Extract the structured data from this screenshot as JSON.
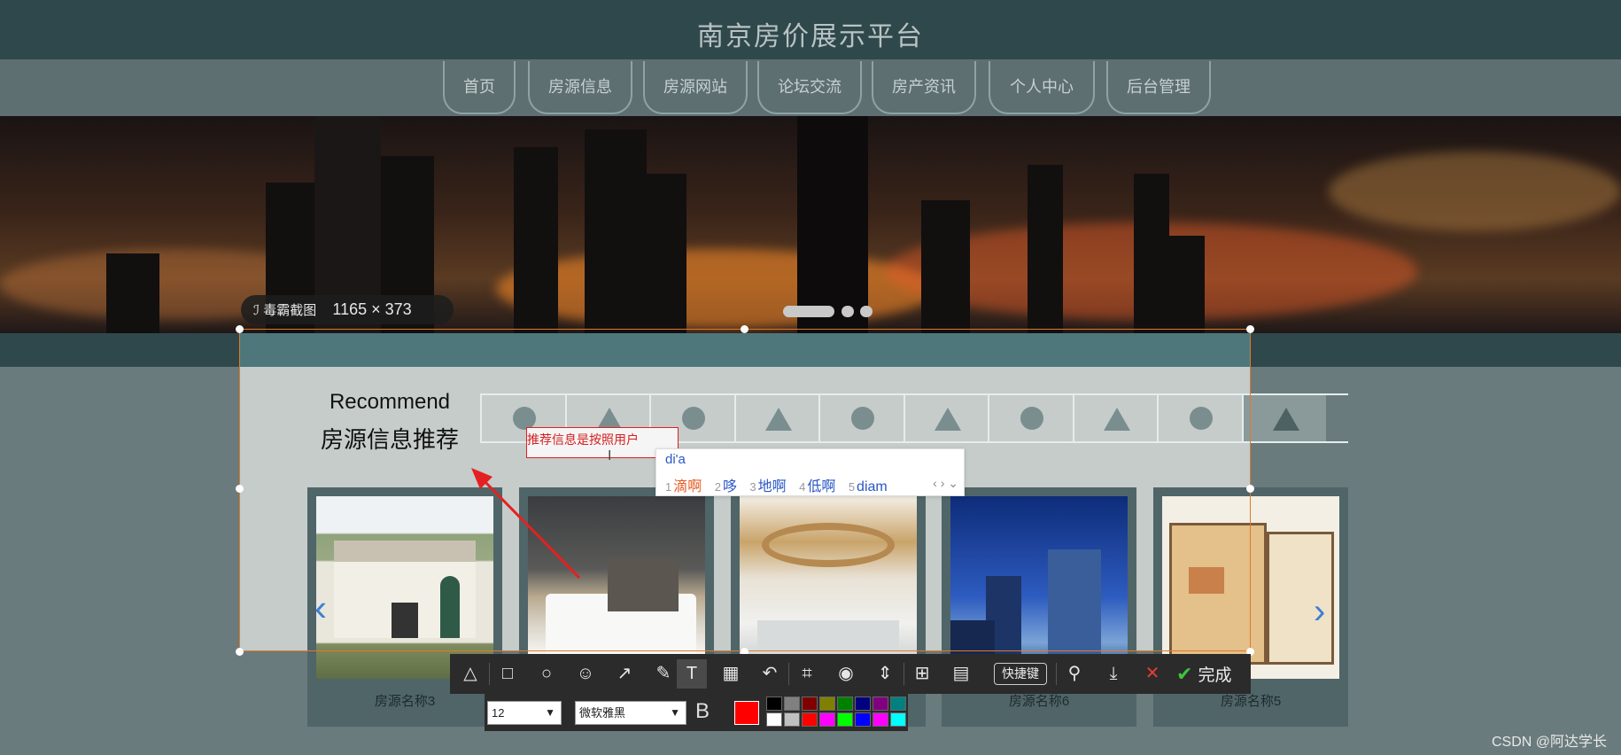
{
  "header": {
    "title": "南京房价展示平台"
  },
  "nav": {
    "tabs": [
      {
        "label": "首页"
      },
      {
        "label": "房源信息"
      },
      {
        "label": "房源网站"
      },
      {
        "label": "论坛交流"
      },
      {
        "label": "房产资讯"
      },
      {
        "label": "个人中心"
      },
      {
        "label": "后台管理"
      }
    ]
  },
  "capture_tool": {
    "brand": "毒霸截图",
    "size": "1165 × 373"
  },
  "recommend": {
    "en": "Recommend",
    "zh": "房源信息推荐"
  },
  "cards": [
    {
      "caption": "房源名称3"
    },
    {
      "caption": ""
    },
    {
      "caption": ""
    },
    {
      "caption": "房源名称6"
    },
    {
      "caption": "房源名称5"
    }
  ],
  "annotation": {
    "text": "推荐信息是按照用户"
  },
  "ime": {
    "input": "di'a",
    "candidates": [
      {
        "n": "1",
        "text": "滴啊"
      },
      {
        "n": "2",
        "text": "哆"
      },
      {
        "n": "3",
        "text": "地啊"
      },
      {
        "n": "4",
        "text": "低啊"
      },
      {
        "n": "5",
        "text": "diam"
      }
    ]
  },
  "toolbar": {
    "hotkey_label": "快捷键",
    "finish_label": "完成",
    "font_size": "12",
    "font_name": "微软雅黑",
    "bold_label": "B",
    "current_color": "#ff0000",
    "palette": [
      "#000000",
      "#808080",
      "#800000",
      "#808000",
      "#008000",
      "#000080",
      "#800080",
      "#008080",
      "#ffffff",
      "#c0c0c0",
      "#ff0000",
      "#ff00ff",
      "#00ff00",
      "#0000ff",
      "#ff00ff",
      "#00ffff"
    ]
  },
  "watermark": "CSDN @阿达学长"
}
